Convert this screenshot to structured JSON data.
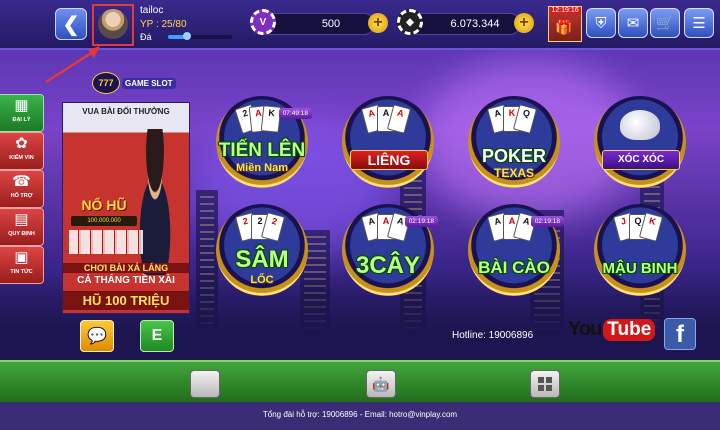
{
  "topbar": {
    "username": "tailoc",
    "vp_label": "YP :",
    "vp_value": "25/80",
    "rank": "Đá",
    "xp_progress": 0.3,
    "chip_balance": "500",
    "coin_balance": "6.073.344",
    "clock_time": "12:19:16"
  },
  "sidebar": {
    "items": [
      {
        "label": "ĐẠI LÝ",
        "icon": "store-icon"
      },
      {
        "label": "KIẾM VIN",
        "icon": "gift-icon"
      },
      {
        "label": "HỖ TRỢ",
        "icon": "support-icon"
      },
      {
        "label": "QUY ĐỊNH",
        "icon": "book-icon"
      },
      {
        "label": "TIN TỨC",
        "icon": "news-icon"
      }
    ]
  },
  "brand": {
    "number": "777",
    "text": "GAME SLOT"
  },
  "banner": {
    "headline": "VUA BÀI ĐỔI THƯỞNG",
    "jackpot_word": "NỔ HŨ",
    "jackpot_amount": "100.000.000",
    "line1": "CHƠI BÀI XẢ LÁNG",
    "line2": "CẢ THÁNG TIỀN XÀI",
    "line3": "HŨ 100 TRIỆU"
  },
  "chat_button_icon": "chat-icon",
  "e_button_label": "E",
  "games": [
    {
      "title": "TIẾN LÊN",
      "subtitle": "Miền Nam",
      "timer": "07:49:18"
    },
    {
      "title": "LIÊNG",
      "subtitle": "",
      "timer": ""
    },
    {
      "title": "POKER",
      "subtitle": "TEXAS",
      "timer": ""
    },
    {
      "title": "XÓC XÓC",
      "subtitle": "",
      "timer": ""
    },
    {
      "title": "SÂM",
      "subtitle": "LỐC",
      "timer": ""
    },
    {
      "title": "3CÂY",
      "subtitle": "",
      "timer": "02:19:18"
    },
    {
      "title": "BÀI CÀO",
      "subtitle": "",
      "timer": "02:19:18"
    },
    {
      "title": "MẬU BINH",
      "subtitle": "",
      "timer": ""
    }
  ],
  "hotline": "Hotline: 19006896",
  "youtube": {
    "you": "You",
    "tube": "Tube"
  },
  "facebook": "f",
  "footer": "Tổng đài hỗ trợ: 19006896 - Email: hotro@vinplay.com",
  "colors": {
    "topbar": "#241a63",
    "accent_gold": "#ffd84a",
    "bottom_bar": "#43a63b"
  }
}
